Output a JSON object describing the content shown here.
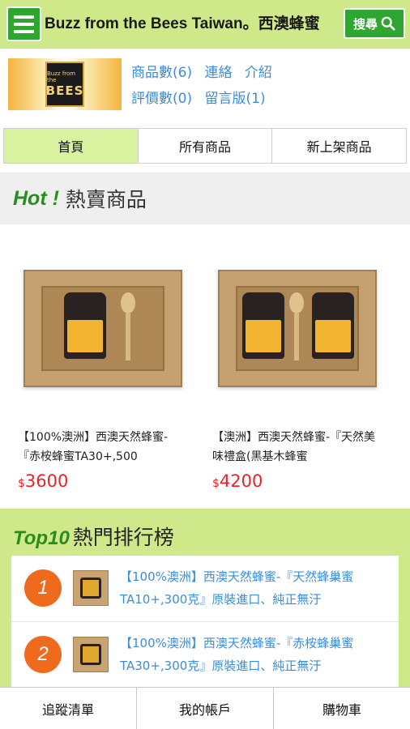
{
  "header": {
    "title": "Buzz from the Bees Taiwan。西澳蜂蜜",
    "search_label": "搜尋",
    "menu_icon": "hamburger-menu-icon",
    "search_icon": "magnifier-icon"
  },
  "shop": {
    "logo_text": "BEES",
    "logo_small_text": "Buzz from the",
    "links": [
      {
        "label": "商品數(6)"
      },
      {
        "label": "連絡"
      },
      {
        "label": "介紹"
      },
      {
        "label": "評價數(0)"
      },
      {
        "label": "留言版(1)"
      }
    ]
  },
  "tabs": [
    {
      "label": "首頁",
      "active": true
    },
    {
      "label": "所有商品",
      "active": false
    },
    {
      "label": "新上架商品",
      "active": false
    }
  ],
  "hot": {
    "accent": "Hot !",
    "title": "熱賣商品"
  },
  "products": [
    {
      "name": "【100%澳洲】西澳天然蜂蜜-『赤桉蜂蜜TA30+,500",
      "currency": "$",
      "price": "3600"
    },
    {
      "name": "【澳洲】西澳天然蜂蜜-『天然美味禮盒(黑基木蜂蜜",
      "currency": "$",
      "price": "4200"
    }
  ],
  "top10": {
    "accent": "Top10",
    "title": "熱門排行榜",
    "items": [
      {
        "rank": "1",
        "text": "【100%澳洲】西澳天然蜂蜜-『天然蜂巢蜜TA10+,300克』原裝進口、純正無汙"
      },
      {
        "rank": "2",
        "text": "【100%澳洲】西澳天然蜂蜜-『赤桉蜂巢蜜TA30+,300克』原裝進口、純正無汙"
      }
    ]
  },
  "bottom_nav": [
    {
      "label": "追蹤清單"
    },
    {
      "label": "我的帳戶"
    },
    {
      "label": "購物車"
    }
  ],
  "colors": {
    "header_bg": "#cfe98a",
    "button_green": "#2fa62f",
    "link_blue": "#3a8ed8",
    "price_red": "#e42626",
    "accent_green": "#2a8c1e",
    "rank_orange": "#f06a1e"
  }
}
